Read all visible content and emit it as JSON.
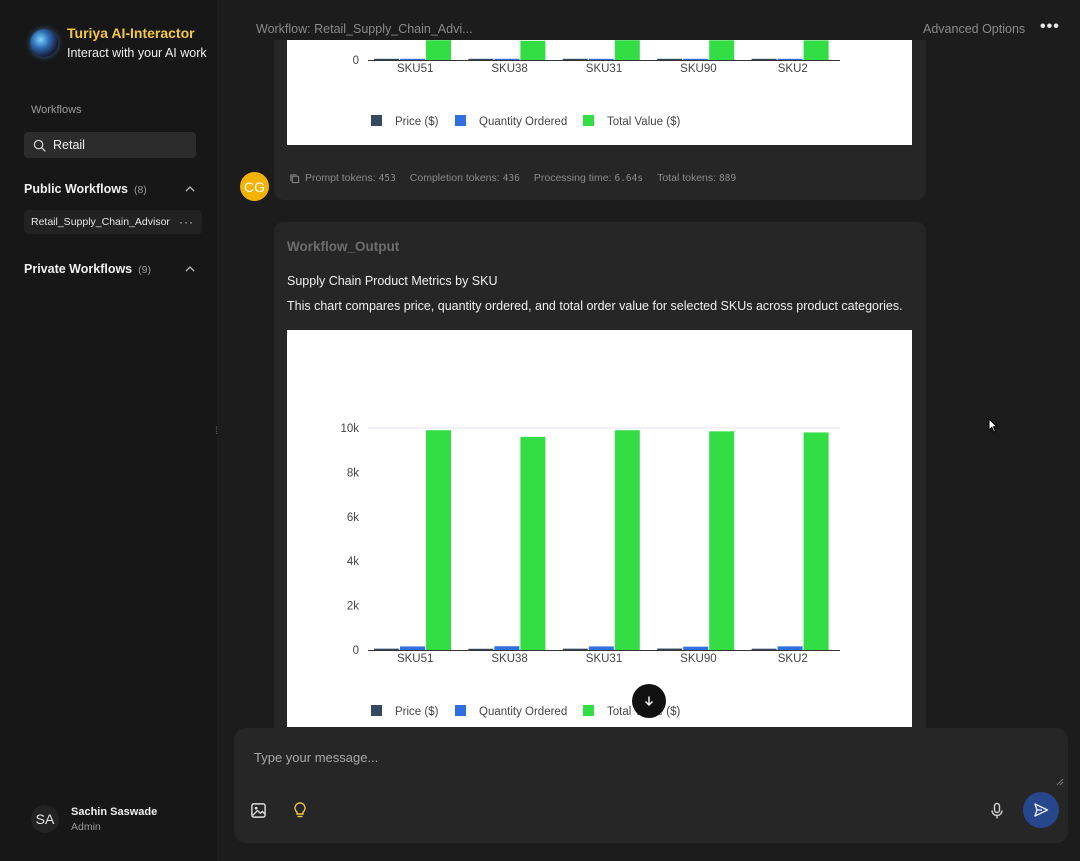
{
  "app": {
    "title": "Turiya AI-Interactor",
    "subtitle": "Interact with your AI work"
  },
  "sidebar": {
    "workflows_label": "Workflows",
    "search_value": "Retail",
    "public": {
      "title": "Public Workflows",
      "count": "(8)",
      "items": [
        "Retail_Supply_Chain_Advisor"
      ]
    },
    "private": {
      "title": "Private Workflows",
      "count": "(9)"
    }
  },
  "user": {
    "initials": "SA",
    "name": "Sachin Saswade",
    "role": "Admin"
  },
  "header": {
    "workflow_title": "Workflow: Retail_Supply_Chain_Advi...",
    "advanced_options": "Advanced Options",
    "more": "•••"
  },
  "message1": {
    "avatar": "CG",
    "tokens": {
      "prompt_label": "Prompt tokens:",
      "prompt_value": "453",
      "completion_label": "Completion tokens:",
      "completion_value": "436",
      "time_label": "Processing time:",
      "time_value": "6.64s",
      "total_label": "Total tokens:",
      "total_value": "889"
    }
  },
  "message2": {
    "output_title": "Workflow_Output",
    "chart_heading": "Supply Chain Product Metrics by SKU",
    "chart_description": "This chart compares price, quantity ordered, and total order value for selected SKUs across product categories."
  },
  "composer": {
    "placeholder": "Type your message..."
  },
  "colors": {
    "price": "#34495e",
    "quantity": "#2f6fe0",
    "total": "#33dd44",
    "accent": "#f5c842"
  },
  "chart_data": [
    {
      "type": "bar",
      "categories": [
        "SKU51",
        "SKU38",
        "SKU31",
        "SKU90",
        "SKU2"
      ],
      "series": [
        {
          "name": "Price ($)",
          "values": [
            60,
            55,
            60,
            65,
            58
          ]
        },
        {
          "name": "Quantity Ordered",
          "values": [
            160,
            170,
            160,
            150,
            165
          ]
        },
        {
          "name": "Total Value ($)",
          "values": [
            9900,
            9600,
            9900,
            9850,
            9800
          ]
        }
      ],
      "yticks": [
        "0"
      ],
      "legend": "bottom"
    },
    {
      "type": "bar",
      "categories": [
        "SKU51",
        "SKU38",
        "SKU31",
        "SKU90",
        "SKU2"
      ],
      "series": [
        {
          "name": "Price ($)",
          "values": [
            60,
            55,
            60,
            65,
            58
          ]
        },
        {
          "name": "Quantity Ordered",
          "values": [
            160,
            170,
            160,
            150,
            165
          ]
        },
        {
          "name": "Total Value ($)",
          "values": [
            9900,
            9600,
            9900,
            9850,
            9800
          ]
        }
      ],
      "ylim": [
        0,
        10000
      ],
      "yticks": [
        "0",
        "2k",
        "4k",
        "6k",
        "8k",
        "10k"
      ],
      "legend": "bottom"
    }
  ]
}
